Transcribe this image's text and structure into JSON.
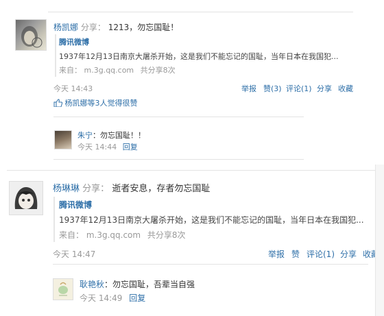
{
  "posts": [
    {
      "user": "杨凯娜",
      "verb": "分享：",
      "text": "1213，勿忘国耻！",
      "source_name": "腾讯微博",
      "snippet": "1937年12月13日南京大屠杀开始，这是我们不能忘记的国耻，当年日本在我国犯...",
      "from_label": "来自：",
      "from_url": "m.3g.qq.com",
      "share_count": "共分享8次",
      "time": "今天 14:43",
      "actions": [
        "举报",
        "赞(3)",
        "评论(1)",
        "分享",
        "收藏"
      ],
      "likes_text": "杨凯娜等3人觉得很赞",
      "comment": {
        "user": "朱宁",
        "text": "：勿忘国耻！！",
        "time": "今天 14:44",
        "reply": "回复"
      }
    },
    {
      "user": "杨琳琳",
      "verb": "分享：",
      "text": "逝者安息，存者勿忘国耻",
      "source_name": "腾讯微博",
      "snippet": "1937年12月13日南京大屠杀开始，这是我们不能忘记的国耻，当年日本在我国犯...",
      "from_label": "来自：",
      "from_url": "m.3g.qq.com",
      "share_count": "共分享8次",
      "time": "今天 14:47",
      "actions": [
        "举报",
        "赞",
        "评论(1)",
        "分享",
        "收藏"
      ],
      "comment": {
        "user": "耿艳秋",
        "text": "：勿忘国耻，吾辈当自强",
        "time": "今天 14:49",
        "reply": "回复"
      }
    }
  ],
  "colors": {
    "link": "#2e6fa8",
    "muted": "#999999",
    "divider": "#e3e3e3"
  },
  "icons": {
    "like": "thumbs-up-icon"
  }
}
